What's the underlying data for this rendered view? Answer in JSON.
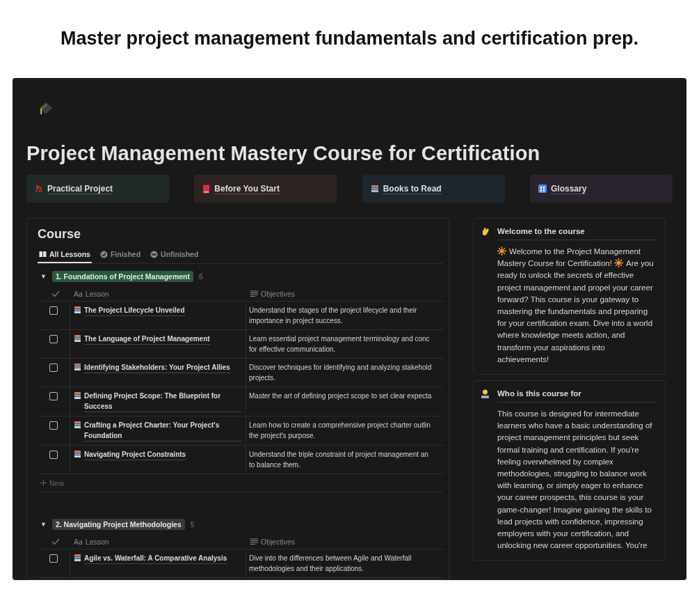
{
  "headline": "Master project management fundamentals and certification prep.",
  "page": {
    "title": "Project Management Mastery Course for Certification",
    "links": [
      {
        "kind": "project",
        "label": "Practical Project",
        "color": "#212a26"
      },
      {
        "kind": "rules",
        "label": "Before You Start",
        "color": "#2c2420"
      },
      {
        "kind": "books",
        "label": "Books to Read",
        "color": "#1d262d"
      },
      {
        "kind": "glossary",
        "label": "Glossary",
        "color": "#28232c"
      }
    ]
  },
  "course": {
    "title": "Course",
    "tabs": [
      {
        "kind": "book",
        "label": "All Lessons",
        "selected": true
      },
      {
        "kind": "badge",
        "label": "Finished",
        "selected": false
      },
      {
        "kind": "minus",
        "label": "Unfinished",
        "selected": false
      }
    ],
    "groups": [
      {
        "toggle": "▼",
        "expanded": true,
        "name": "1. Foundations of Project Management",
        "color": "#2b5a3e",
        "count": "6",
        "columns": [
          {
            "type_label": "Aa",
            "label": "Lesson"
          },
          {
            "label": "Objectives"
          }
        ],
        "rows": [
          {
            "checked": false,
            "lesson": "The Project Lifecycle Unveiled",
            "objective": "Understand the stages of the project lifecycle and their\nimportance in project success."
          },
          {
            "checked": false,
            "lesson": "The Language of Project Management",
            "objective": "Learn essential project management terminology and conc\nfor effective communication."
          },
          {
            "checked": false,
            "lesson": "Identifying Stakeholders: Your Project Allies",
            "objective": "Discover techniques for identifying and analyzing stakehold\nprojects."
          },
          {
            "checked": false,
            "lesson": "Defining Project Scope: The Blueprint for Success",
            "objective": "Master the art of defining project scope to set clear expecta"
          },
          {
            "checked": false,
            "lesson": "Crafting a Project Charter: Your Project's Foundation",
            "objective": "Learn how to create a comprehensive project charter outlin\nthe project's purpose."
          },
          {
            "checked": false,
            "lesson": "Navigating Project Constraints",
            "objective": "Understand the triple constraint of project management an\nto balance them."
          }
        ],
        "new_label": "New"
      },
      {
        "toggle": "▼",
        "expanded": true,
        "name": "2. Navigating Project Methodologies",
        "color": "#3a3a3a",
        "count": "5",
        "columns": [
          {
            "type_label": "Aa",
            "label": "Lesson"
          },
          {
            "label": "Objectives"
          }
        ],
        "rows": [
          {
            "checked": false,
            "lesson": "Agile vs. Waterfall: A Comparative Analysis",
            "objective": "Dive into the differences between Agile and Waterfall\nmethodologies and their applications."
          }
        ]
      }
    ]
  },
  "callouts": [
    {
      "kind": "wave",
      "title": "Welcome to the course",
      "parts": [
        {
          "kind": "sun"
        },
        {
          "kind": "line",
          "text": "Welcome to the Project Management"
        },
        {
          "kind": "break"
        },
        {
          "kind": "line",
          "text": "Mastery Course for Certification!"
        },
        {
          "kind": "sun"
        },
        {
          "kind": "line",
          "text": "Are you"
        },
        {
          "kind": "text",
          "text": "ready to unlock the secrets of effective project management and propel your career forward? This course is your gateway to mastering the fundamentals and preparing for your certification exam. Dive into a world where knowledge meets action, and transform your aspirations into achievements!"
        }
      ]
    },
    {
      "kind": "person",
      "title": "Who is this course for",
      "parts": [
        {
          "kind": "text",
          "text": "This course is designed for intermediate learners who have a basic understanding of project management principles but seek formal training and certification. If you're feeling overwhelmed by complex methodologies, struggling to balance work with learning, or simply eager to enhance your career prospects, this course is your game-changer! Imagine gaining the skills to lead projects with confidence, impressing employers with your certification, and unlocking new career opportunities. You're"
        }
      ]
    }
  ]
}
